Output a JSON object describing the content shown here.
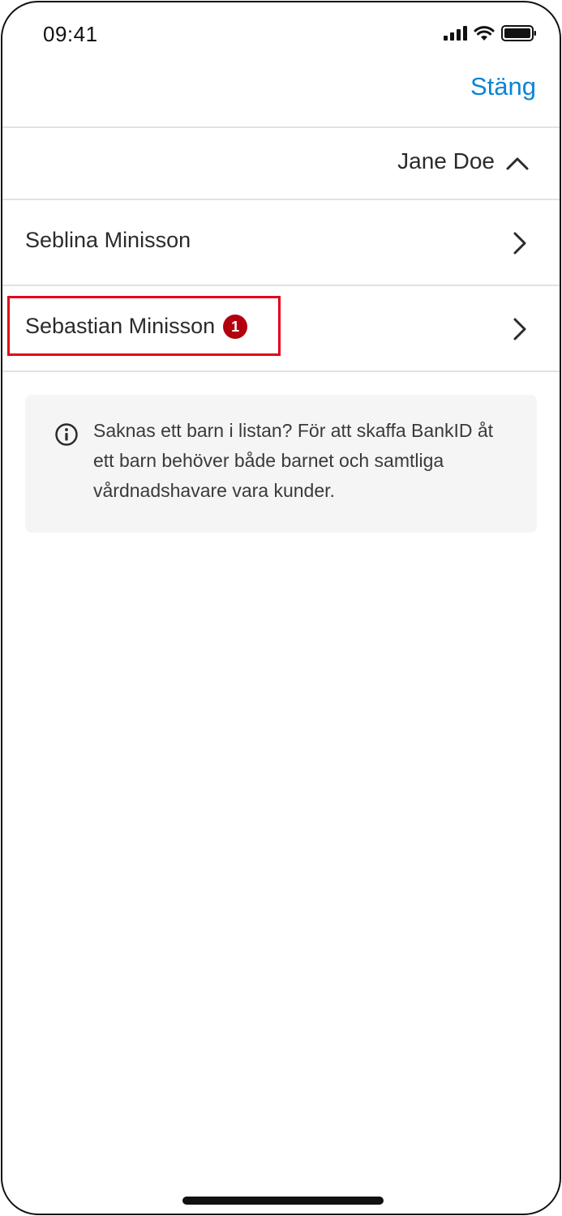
{
  "status_bar": {
    "time": "09:41",
    "icons": [
      "signal-icon",
      "wifi-icon",
      "battery-icon"
    ]
  },
  "nav": {
    "close_label": "Stäng"
  },
  "account": {
    "name": "Jane Doe",
    "expanded": true
  },
  "children": [
    {
      "name": "Seblina Minisson",
      "badge": null
    },
    {
      "name": "Sebastian Minisson",
      "badge": "1",
      "highlighted": true
    }
  ],
  "info": {
    "icon": "info-icon",
    "text": "Saknas ett barn i listan? För att skaffa BankID åt ett barn behöver både barnet och samtliga vårdnadshavare vara kunder."
  },
  "colors": {
    "accent": "#0a84d6",
    "badge": "#b3000f",
    "highlight": "#e4001b",
    "info_bg": "#f5f5f5"
  }
}
